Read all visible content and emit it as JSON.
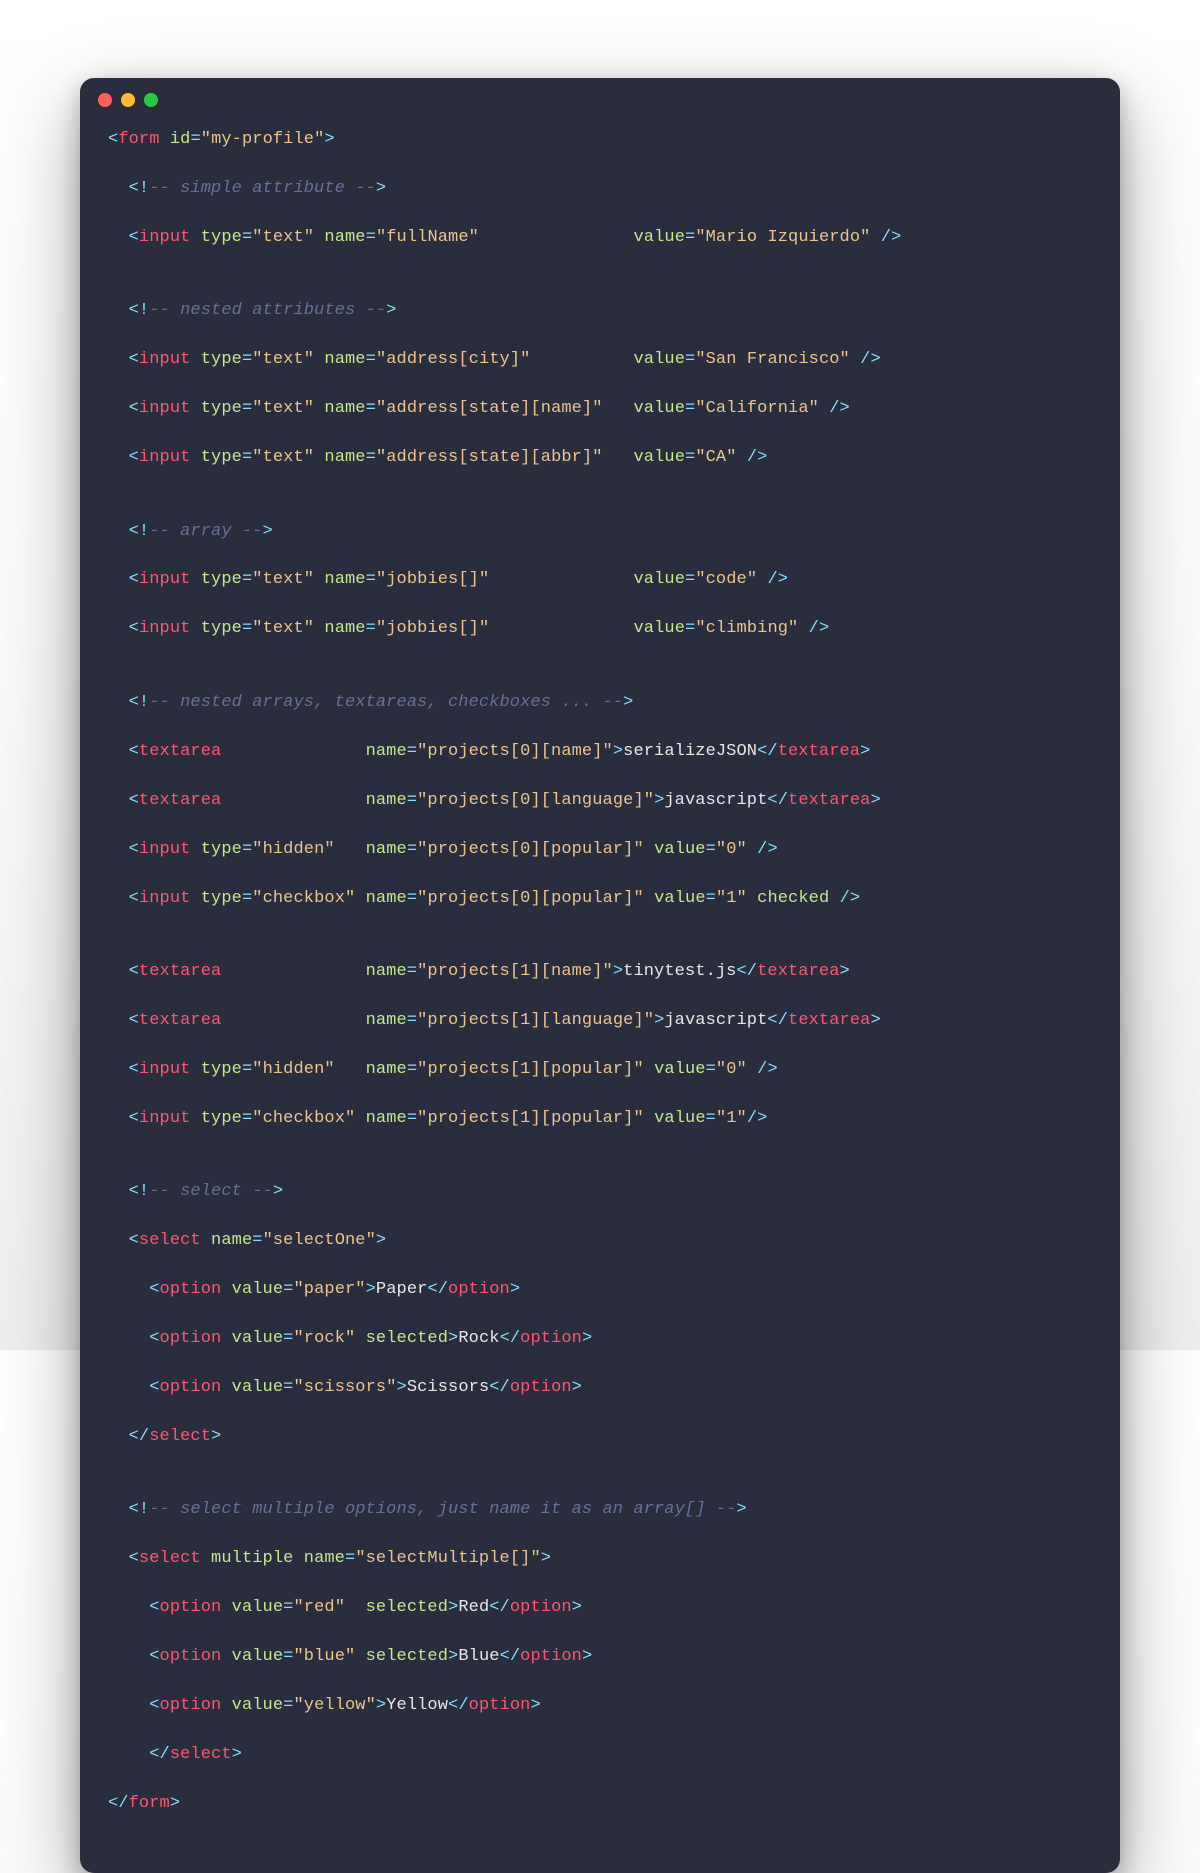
{
  "window": {
    "dots": [
      "red",
      "yellow",
      "green"
    ]
  },
  "tokens": {
    "form": "form",
    "input": "input",
    "textarea": "textarea",
    "select": "select",
    "option": "option",
    "type": "type",
    "name": "name",
    "value": "value",
    "id": "id",
    "multiple": "multiple",
    "selected": "selected",
    "checked": "checked"
  },
  "comments": {
    "c1": "-- simple attribute --",
    "c2": "-- nested attributes --",
    "c3": "-- array --",
    "c4": "-- nested arrays, textareas, checkboxes ... --",
    "c5": "-- select --",
    "c6": "-- select multiple options, just name it as an array[] --"
  },
  "code": {
    "formId": "\"my-profile\"",
    "typeText": "\"text\"",
    "typeHidden": "\"hidden\"",
    "typeCheckbox": "\"checkbox\"",
    "name_fullName": "\"fullName\"",
    "val_fullName": "\"Mario Izquierdo\"",
    "name_city": "\"address[city]\"",
    "val_city": "\"San Francisco\"",
    "name_stateName": "\"address[state][name]\"",
    "val_stateName": "\"California\"",
    "name_stateAbbr": "\"address[state][abbr]\"",
    "val_stateAbbr": "\"CA\"",
    "name_jobbies": "\"jobbies[]\"",
    "val_jobbies1": "\"code\"",
    "val_jobbies2": "\"climbing\"",
    "name_p0name": "\"projects[0][name]\"",
    "txt_p0name": "serializeJSON",
    "name_p0lang": "\"projects[0][language]\"",
    "txt_p0lang": "javascript",
    "name_p0pop": "\"projects[0][popular]\"",
    "val_0": "\"0\"",
    "val_1": "\"1\"",
    "name_p1name": "\"projects[1][name]\"",
    "txt_p1name": "tinytest.js",
    "name_p1lang": "\"projects[1][language]\"",
    "txt_p1lang": "javascript",
    "name_p1pop": "\"projects[1][popular]\"",
    "name_selectOne": "\"selectOne\"",
    "opt_paper_v": "\"paper\"",
    "opt_paper_t": "Paper",
    "opt_rock_v": "\"rock\"",
    "opt_rock_t": "Rock",
    "opt_scissors_v": "\"scissors\"",
    "opt_scissors_t": "Scissors",
    "name_selectMulti": "\"selectMultiple[]\"",
    "opt_red_v": "\"red\"",
    "opt_red_t": "Red",
    "opt_blue_v": "\"blue\"",
    "opt_blue_t": "Blue",
    "opt_yellow_v": "\"yellow\"",
    "opt_yellow_t": "Yellow"
  }
}
